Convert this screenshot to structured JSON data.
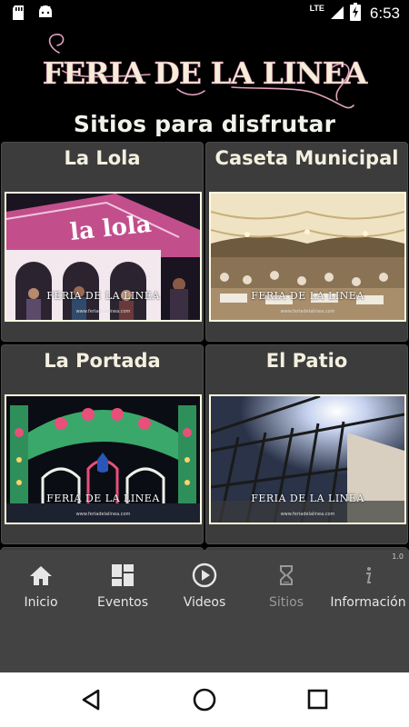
{
  "status_bar": {
    "network": "LTE",
    "time": "6:53"
  },
  "header": {
    "logo_text": "FERIA DE LA LINEA",
    "subtitle": "Sitios para disfrutar"
  },
  "cards": [
    {
      "title": "La Lola",
      "sign_text": "la lola",
      "watermark": "FERIA DE LA LINEA",
      "url": "www.feriadelalinea.com"
    },
    {
      "title": "Caseta Municipal",
      "watermark": "FERIA DE LA LINEA",
      "url": "www.feriadelalinea.com"
    },
    {
      "title": "La Portada",
      "watermark": "FERIA DE LA LINEA",
      "url": "www.feriadelalinea.com"
    },
    {
      "title": "El Patio",
      "watermark": "FERIA DE LA LINEA",
      "url": "www.feriadelalinea.com"
    }
  ],
  "bottom_nav": {
    "version": "1.0",
    "items": [
      {
        "label": "Inicio",
        "icon": "home-icon"
      },
      {
        "label": "Eventos",
        "icon": "dashboard-icon"
      },
      {
        "label": "Videos",
        "icon": "play-circle-icon"
      },
      {
        "label": "Sitios",
        "icon": "hourglass-icon",
        "active": true
      },
      {
        "label": "Información",
        "icon": "info-icon"
      }
    ]
  },
  "colors": {
    "background": "#000000",
    "card_bg": "#3c3c3c",
    "nav_bg": "#434343",
    "text_cream": "#f4f0e0",
    "logo_pink": "#e9a0c0"
  }
}
